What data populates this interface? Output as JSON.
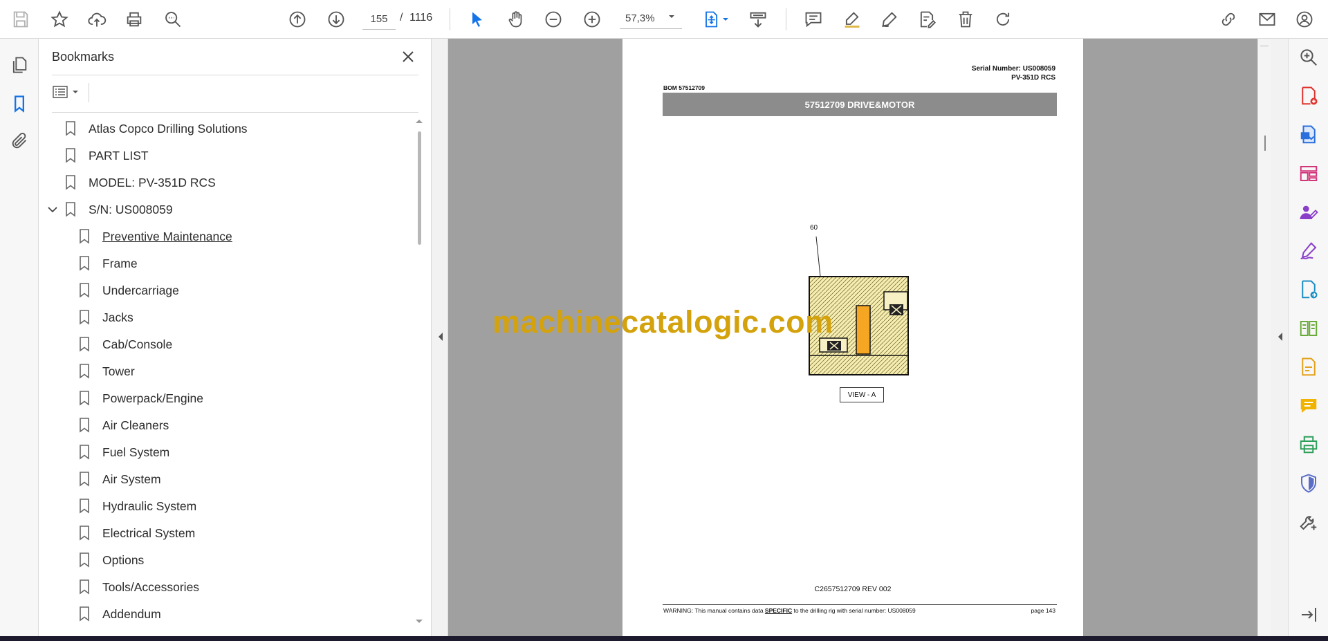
{
  "toolbar": {
    "current_page": "155",
    "page_separator": "/",
    "total_pages": "1116",
    "zoom": "57,3%"
  },
  "bookmarks": {
    "title": "Bookmarks",
    "items": [
      {
        "label": "Atlas Copco Drilling Solutions",
        "level": 0
      },
      {
        "label": "PART LIST",
        "level": 0
      },
      {
        "label": "MODEL: PV-351D RCS",
        "level": 0
      },
      {
        "label": "S/N: US008059",
        "level": 0,
        "expanded": true
      },
      {
        "label": "Preventive Maintenance",
        "level": 1,
        "underlined": true
      },
      {
        "label": "Frame",
        "level": 1
      },
      {
        "label": "Undercarriage",
        "level": 1
      },
      {
        "label": "Jacks",
        "level": 1
      },
      {
        "label": "Cab/Console",
        "level": 1
      },
      {
        "label": "Tower",
        "level": 1
      },
      {
        "label": "Powerpack/Engine",
        "level": 1
      },
      {
        "label": "Air Cleaners",
        "level": 1
      },
      {
        "label": "Fuel System",
        "level": 1
      },
      {
        "label": "Air System",
        "level": 1
      },
      {
        "label": "Hydraulic System",
        "level": 1
      },
      {
        "label": "Electrical System",
        "level": 1
      },
      {
        "label": "Options",
        "level": 1
      },
      {
        "label": "Tools/Accessories",
        "level": 1
      },
      {
        "label": "Addendum",
        "level": 1
      }
    ]
  },
  "document": {
    "serial_line": "Serial Number: US008059",
    "model_line": "PV-351D RCS",
    "bom": "BOM 57512709",
    "section_title": "57512709 DRIVE&MOTOR",
    "callout": "60",
    "view_label": "VIEW - A",
    "drawing_code": "C2657512709 REV 002",
    "warning_prefix": "WARNING:  This manual contains data ",
    "warning_emphasis": "SPECIFIC",
    "warning_suffix": " to the drilling rig with serial number: US008059",
    "page_number": "page 143",
    "watermark": "machinecatalogic.com"
  },
  "colors": {
    "accent_blue": "#1473e6",
    "band_gray": "#8c8c8c",
    "watermark_gold": "#d4a20c",
    "drawing_fill": "#f6eeb0",
    "drawing_orange": "#f5a623"
  }
}
